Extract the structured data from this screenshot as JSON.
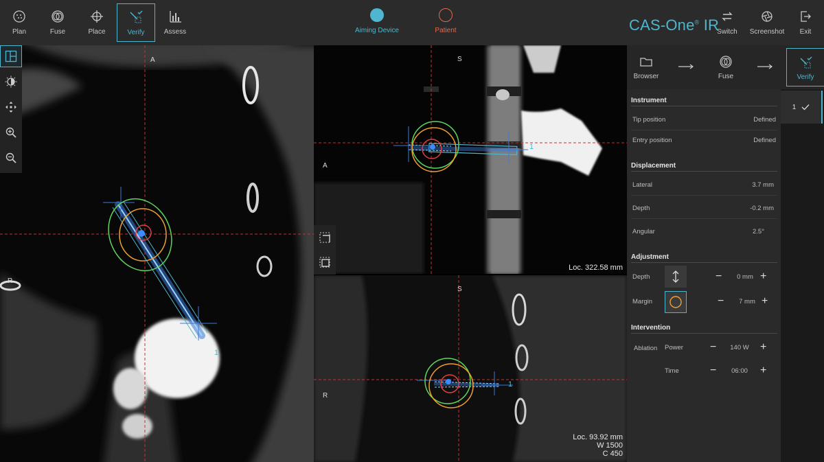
{
  "topbar": {
    "tabs": [
      {
        "label": "Plan",
        "icon": "plan-icon"
      },
      {
        "label": "Fuse",
        "icon": "fuse-icon"
      },
      {
        "label": "Place",
        "icon": "crosshair-icon"
      },
      {
        "label": "Verify",
        "icon": "verify-icon",
        "active": true
      },
      {
        "label": "Assess",
        "icon": "bar-chart-icon"
      }
    ],
    "aiming_device": "Aiming Device",
    "patient": "Patient",
    "brand_name": "CAS-One",
    "brand_mark": "®",
    "brand_suffix": " IR",
    "switch": "Switch",
    "screenshot": "Screenshot",
    "exit": "Exit"
  },
  "colors": {
    "accent": "#4fb6cf",
    "patient": "#e06a4e",
    "margin_circle": "#f0a030",
    "outer_circle": "#5ed55e",
    "inner_circle": "#e04040"
  },
  "viewports": {
    "axial": {
      "top": "A",
      "left": "R",
      "instrument_number": "1"
    },
    "sagittal": {
      "top": "S",
      "left": "A",
      "instrument_number": "1",
      "loc": "Loc. 322.58 mm"
    },
    "coronal": {
      "top": "S",
      "left": "R",
      "instrument_number": "1",
      "loc": "Loc. 93.92 mm",
      "window": "W 1500",
      "center": "C 450"
    }
  },
  "workflow": {
    "steps": [
      {
        "label": "Browser",
        "icon": "folder-icon"
      },
      {
        "label": "Fuse",
        "icon": "fuse-icon"
      },
      {
        "label": "Verify",
        "icon": "verify-icon",
        "active": true
      }
    ]
  },
  "instrument_list": {
    "number": "1",
    "status_icon": "check-icon"
  },
  "panel": {
    "instrument": {
      "title": "Instrument",
      "tip_label": "Tip position",
      "tip_value": "Defined",
      "entry_label": "Entry position",
      "entry_value": "Defined"
    },
    "displacement": {
      "title": "Displacement",
      "lateral_label": "Lateral",
      "lateral_value": "3.7 mm",
      "depth_label": "Depth",
      "depth_value": "-0.2 mm",
      "angular_label": "Angular",
      "angular_value": "2.5°"
    },
    "adjustment": {
      "title": "Adjustment",
      "depth_label": "Depth",
      "depth_value": "0 mm",
      "margin_label": "Margin",
      "margin_value": "7 mm"
    },
    "intervention": {
      "title": "Intervention",
      "ablation_label": "Ablation",
      "power_label": "Power",
      "power_value": "140 W",
      "time_label": "Time",
      "time_value": "06:00"
    }
  }
}
